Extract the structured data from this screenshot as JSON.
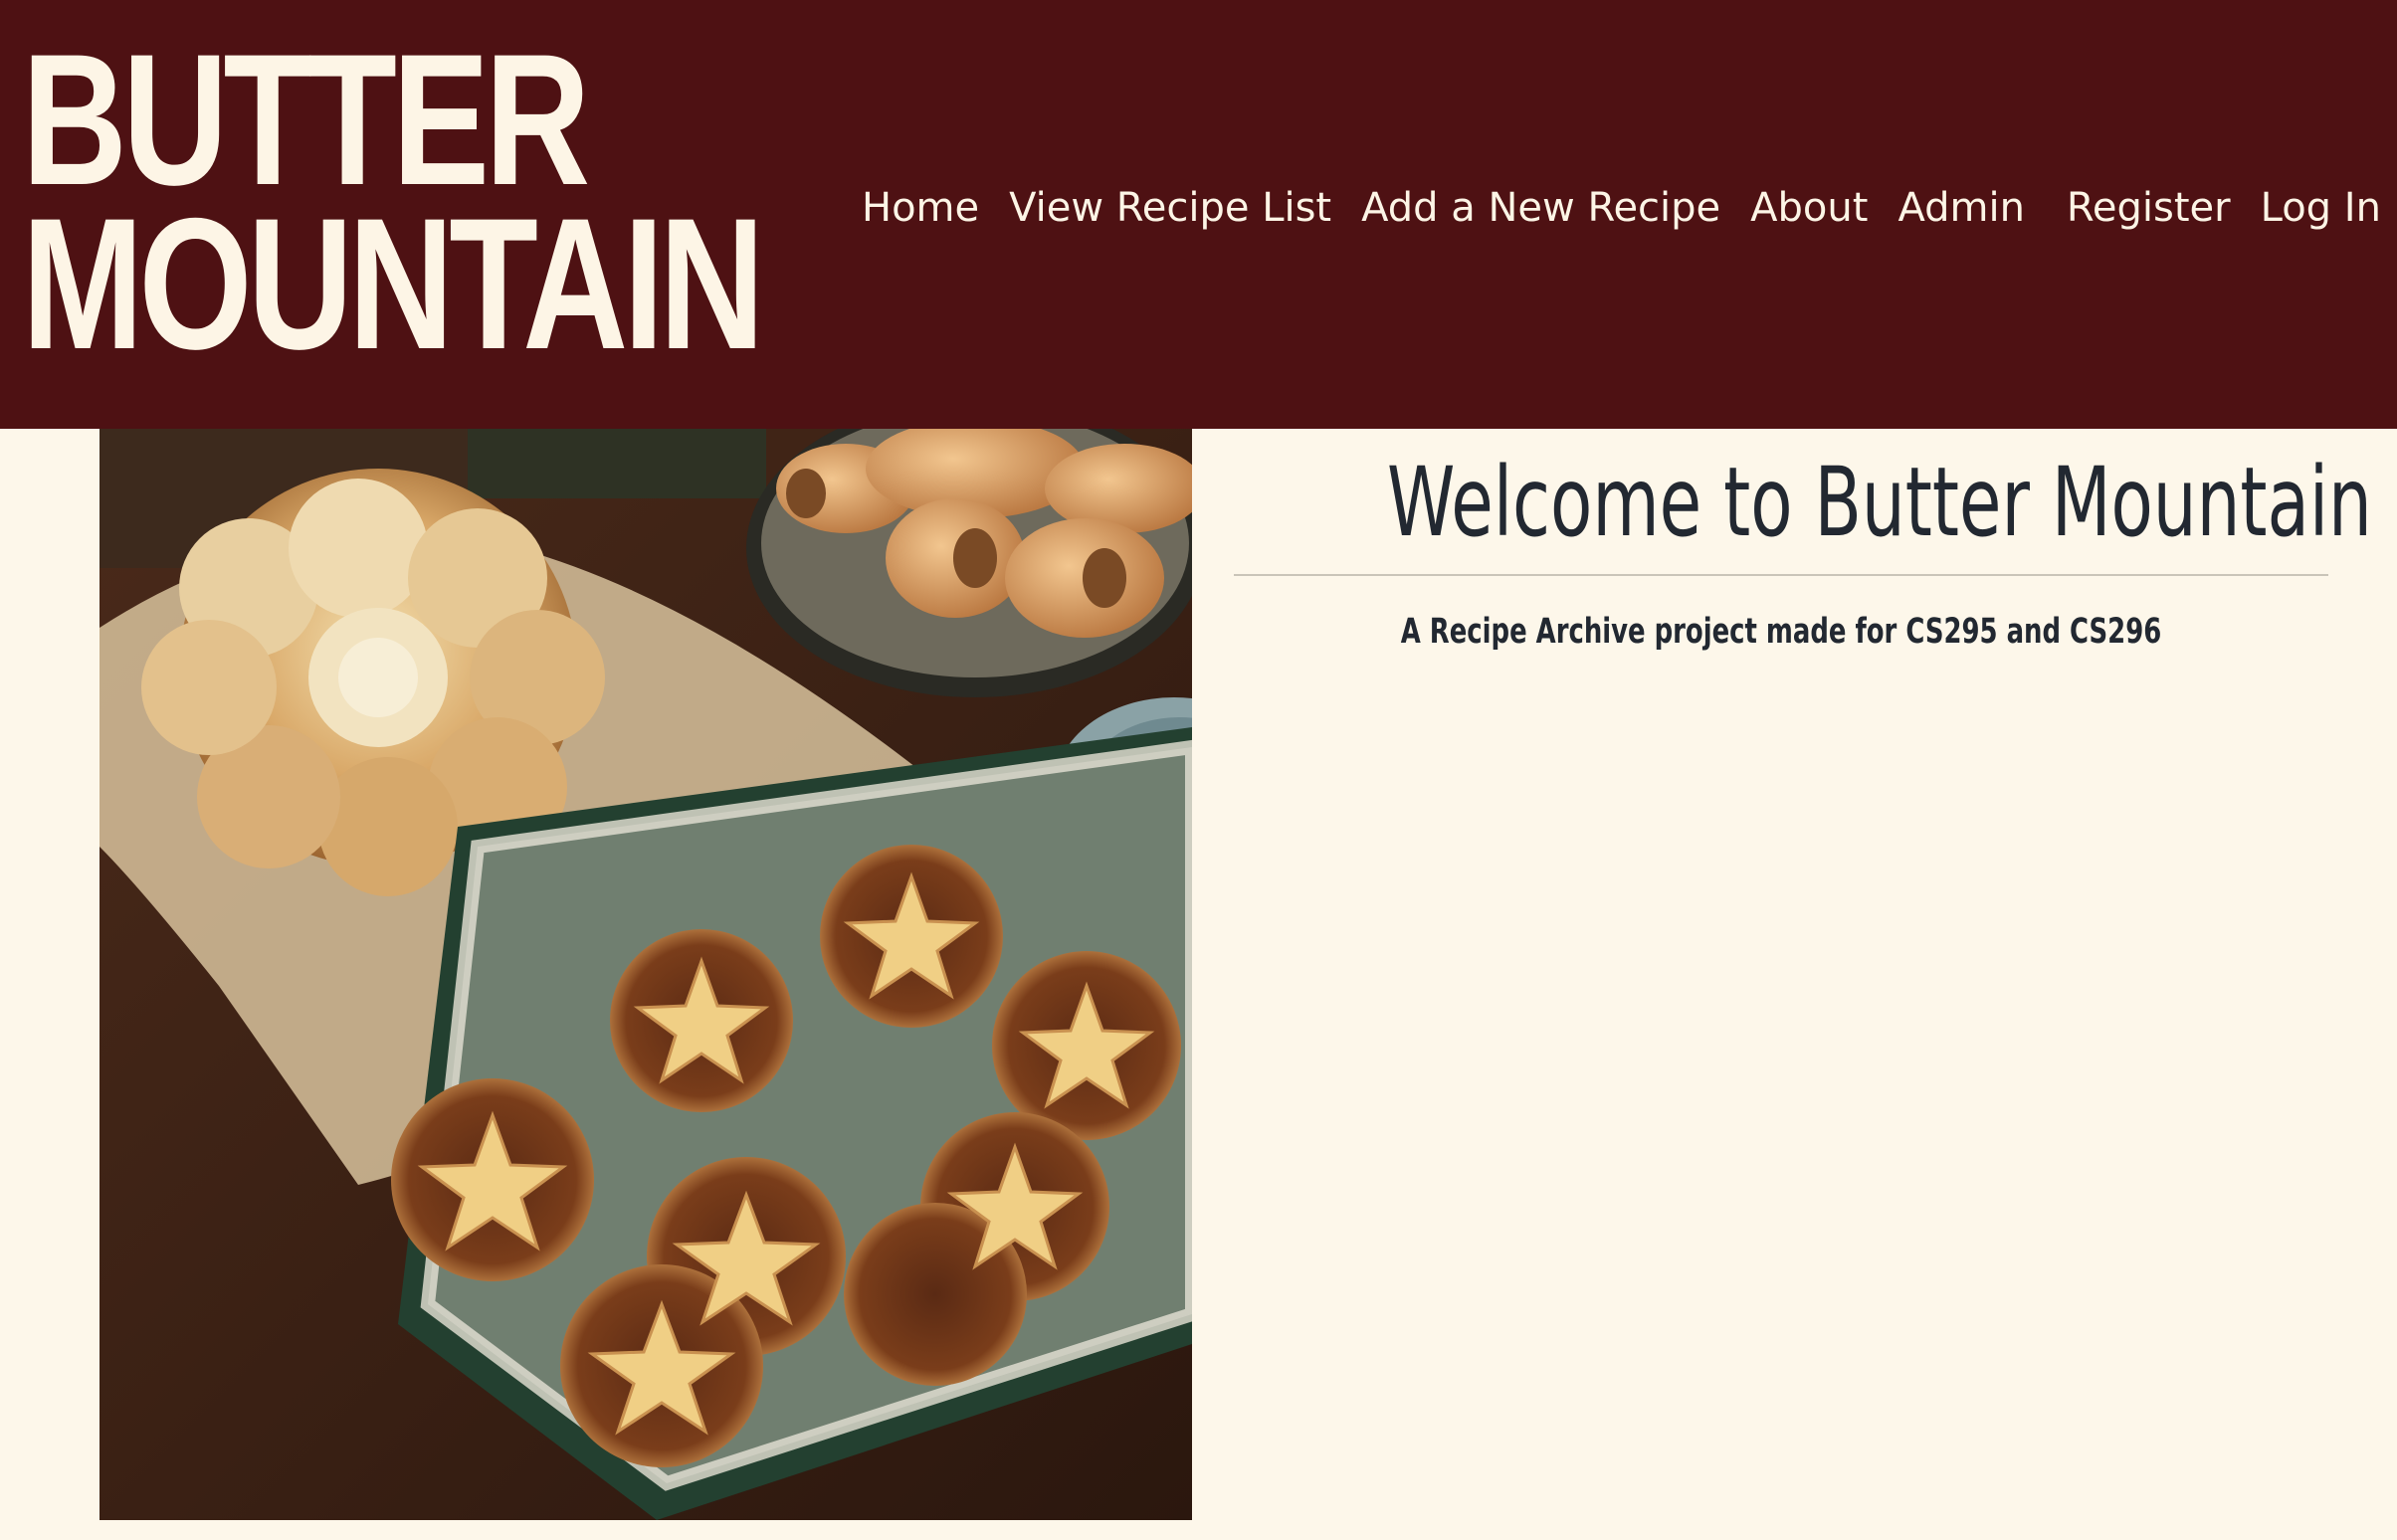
{
  "site": {
    "logo_line1": "BUTTER",
    "logo_line2": "MOUNTAIN"
  },
  "nav": {
    "items": [
      "Home",
      "View Recipe List",
      "Add a New Recipe",
      "About",
      "Admin",
      "Register",
      "Log In"
    ]
  },
  "main": {
    "title": "Welcome to Butter Mountain",
    "subtitle": "A Recipe Archive project made for CS295 and CS296"
  },
  "colors": {
    "header_bg": "#4e1113",
    "page_bg": "#fdf7ea",
    "header_text": "#fdf5e6",
    "body_text": "#222831"
  }
}
